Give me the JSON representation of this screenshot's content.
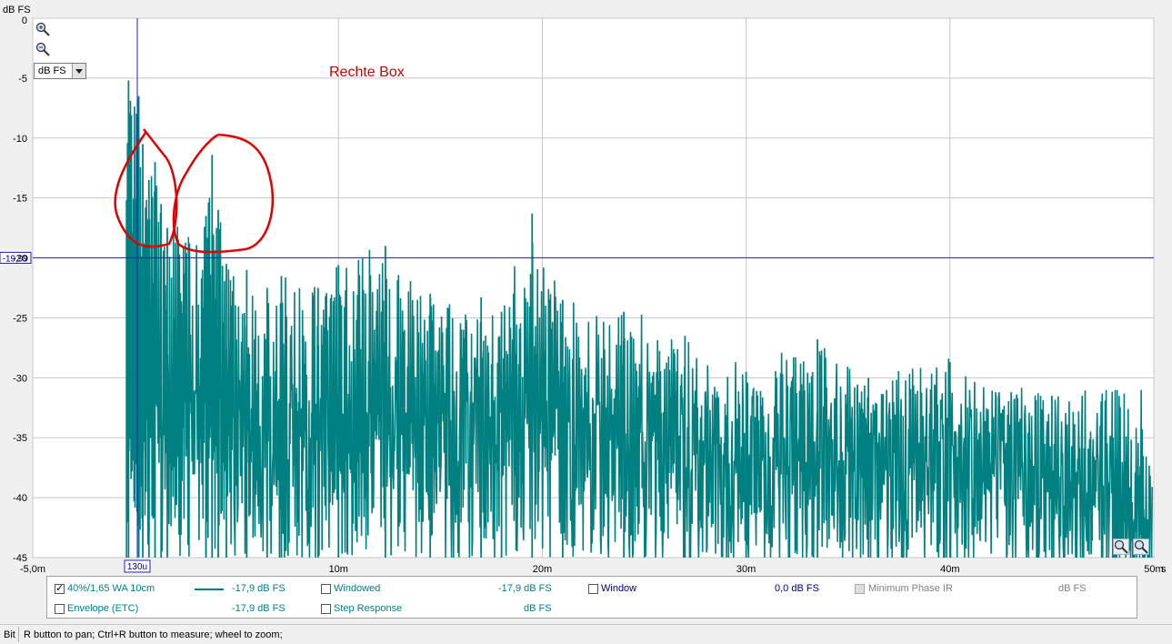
{
  "chart_data": {
    "type": "line",
    "y_unit_label": "dB FS",
    "x_unit_label": "s",
    "xlim": [
      -0.005,
      0.05
    ],
    "ylim": [
      -45,
      0
    ],
    "x_ticks": [
      {
        "v": -0.005,
        "label": "-5,0m"
      },
      {
        "v": 0.01,
        "label": "10m"
      },
      {
        "v": 0.02,
        "label": "20m"
      },
      {
        "v": 0.03,
        "label": "30m"
      },
      {
        "v": 0.04,
        "label": "40m"
      },
      {
        "v": 0.05,
        "label": "50m"
      }
    ],
    "y_ticks": [
      {
        "v": 0,
        "label": "0"
      },
      {
        "v": -5,
        "label": "-5"
      },
      {
        "v": -10,
        "label": "-10"
      },
      {
        "v": -15,
        "label": "-15"
      },
      {
        "v": -20,
        "label": "-20"
      },
      {
        "v": -25,
        "label": "-25"
      },
      {
        "v": -30,
        "label": "-30"
      },
      {
        "v": -35,
        "label": "-35"
      },
      {
        "v": -40,
        "label": "-40"
      },
      {
        "v": -45,
        "label": "-45"
      }
    ],
    "grid": true,
    "annotation": "Rechte Box",
    "cursor": {
      "x_label": "130u",
      "y_value": -19.99,
      "y_label": "-19,99",
      "x_value": 0.00013
    },
    "series": [
      {
        "name": "40%/1,65 WA 10cm",
        "color": "#008080",
        "peaks": [
          {
            "x": -0.0003,
            "y": -5.2
          },
          {
            "x": 0.0002,
            "y": -6.5
          },
          {
            "x": 0.0004,
            "y": -10.5
          },
          {
            "x": 0.0007,
            "y": -13.5
          },
          {
            "x": 0.001,
            "y": -12.0
          },
          {
            "x": 0.0013,
            "y": -15.5
          },
          {
            "x": 0.0016,
            "y": -17.5
          },
          {
            "x": 0.0035,
            "y": -16.5
          },
          {
            "x": 0.0038,
            "y": -11.4
          },
          {
            "x": 0.0041,
            "y": -16.0
          },
          {
            "x": 0.0045,
            "y": -20.5
          },
          {
            "x": 0.0055,
            "y": -21.0
          },
          {
            "x": 0.0065,
            "y": -22.5
          },
          {
            "x": 0.0072,
            "y": -21.5
          },
          {
            "x": 0.009,
            "y": -22.5
          },
          {
            "x": 0.01,
            "y": -20.6
          },
          {
            "x": 0.0123,
            "y": -19.0
          },
          {
            "x": 0.0145,
            "y": -23.0
          },
          {
            "x": 0.017,
            "y": -23.3
          },
          {
            "x": 0.018,
            "y": -24.5
          },
          {
            "x": 0.0195,
            "y": -16.3
          },
          {
            "x": 0.021,
            "y": -23.5
          },
          {
            "x": 0.024,
            "y": -24.5
          },
          {
            "x": 0.027,
            "y": -26.5
          },
          {
            "x": 0.03,
            "y": -29.5
          },
          {
            "x": 0.0335,
            "y": -26.8
          },
          {
            "x": 0.036,
            "y": -30.0
          },
          {
            "x": 0.04,
            "y": -28.7
          },
          {
            "x": 0.045,
            "y": -31.5
          },
          {
            "x": 0.048,
            "y": -35.0
          },
          {
            "x": 0.0495,
            "y": -41.0
          }
        ]
      }
    ]
  },
  "controls": {
    "unit_select": "dB FS",
    "zoom_in_icon": "zoom-in-icon",
    "zoom_out_icon": "zoom-out-icon"
  },
  "legend": {
    "row1": [
      {
        "label": "40%/1,65 WA 10cm",
        "checked": true,
        "value": "-17,9 dB FS",
        "color": "#008080"
      },
      {
        "label": "Windowed",
        "checked": false,
        "value": "-17,9 dB FS",
        "color": "#008080"
      },
      {
        "label": "Window",
        "checked": false,
        "value": "0,0 dB FS",
        "color": "#000080"
      },
      {
        "label": "Minimum Phase IR",
        "checked": false,
        "disabled": true,
        "value": "dB FS",
        "color": "#808080"
      }
    ],
    "row2": [
      {
        "label": "Envelope (ETC)",
        "checked": false,
        "value": "-17,9 dB FS",
        "color": "#008080"
      },
      {
        "label": "Step Response",
        "checked": false,
        "value": "dB FS",
        "color": "#008080"
      }
    ]
  },
  "statusbar": {
    "left": "Bit",
    "hint": "R button to pan; Ctrl+R button to measure; wheel to zoom;"
  }
}
